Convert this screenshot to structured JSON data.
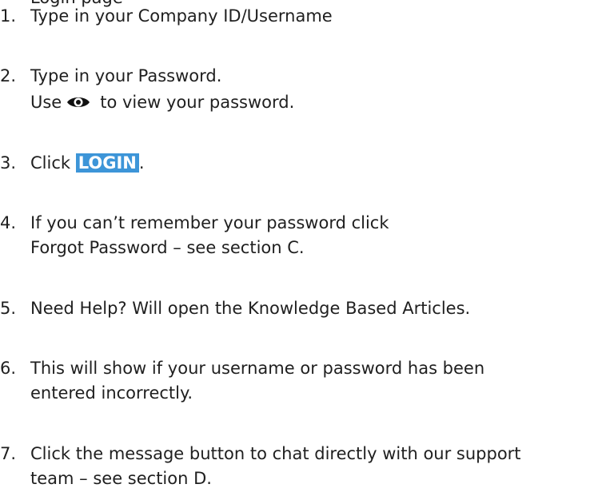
{
  "header_cutoff": "Login page",
  "steps": [
    {
      "num": "1.",
      "text": "Type in your Company ID/Username"
    },
    {
      "num": "2.",
      "text": "Type in your Password.",
      "sub_before": "Use",
      "sub_icon": "eye-icon",
      "sub_after": "to view your password."
    },
    {
      "num": "3.",
      "before": "Click",
      "highlight": "LOGIN",
      "after": "."
    },
    {
      "num": "4.",
      "line1": "If you can’t remember your password click",
      "line2": "Forgot Password – see section C."
    },
    {
      "num": "5.",
      "text": "Need Help? Will open the Knowledge Based Articles."
    },
    {
      "num": "6.",
      "line1": "This will show if your username or password has been",
      "line2": "entered incorrectly."
    },
    {
      "num": "7.",
      "line1": "Click the message button to chat directly with our support",
      "line2": "team – see section D."
    }
  ],
  "colors": {
    "highlight_bg": "#3d95d8",
    "highlight_text": "#ffffff",
    "text": "#1f1f1f"
  }
}
